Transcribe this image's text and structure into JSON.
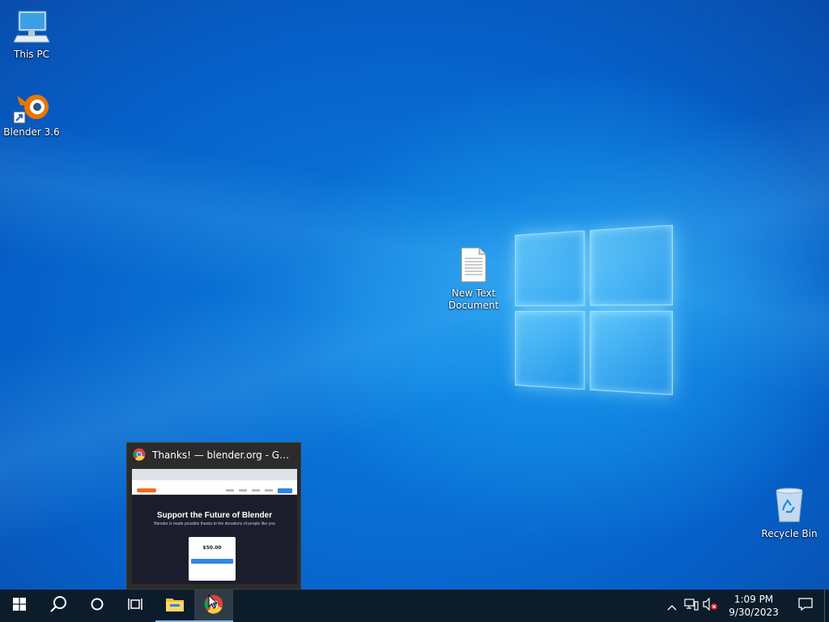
{
  "desktop": {
    "icons": [
      {
        "label": "This PC",
        "icon": "computer-icon"
      },
      {
        "label": "Blender 3.6",
        "icon": "blender-icon"
      },
      {
        "label": "New Text Document",
        "icon": "text-document-icon"
      },
      {
        "label": "Recycle Bin",
        "icon": "recycle-bin-icon"
      }
    ]
  },
  "preview": {
    "title": "Thanks! — blender.org - Googl...",
    "page_heading": "Support the Future of Blender",
    "page_sub": "Blender is made possible thanks to the donations of people like you",
    "amount": "$50.00"
  },
  "taskbar": {
    "buttons": [
      {
        "name": "start",
        "icon": "windows-icon"
      },
      {
        "name": "search",
        "icon": "search-icon"
      },
      {
        "name": "cortana",
        "icon": "cortana-icon"
      },
      {
        "name": "task-view",
        "icon": "task-view-icon"
      },
      {
        "name": "file-explorer",
        "icon": "folder-icon"
      },
      {
        "name": "chrome",
        "icon": "chrome-icon",
        "active": true
      }
    ],
    "tray": {
      "time": "1:09 PM",
      "date": "9/30/2023"
    }
  },
  "colors": {
    "taskbar": "#0d1c2a",
    "accent": "#7ab6ea",
    "desktop": "#0a6fd8"
  }
}
